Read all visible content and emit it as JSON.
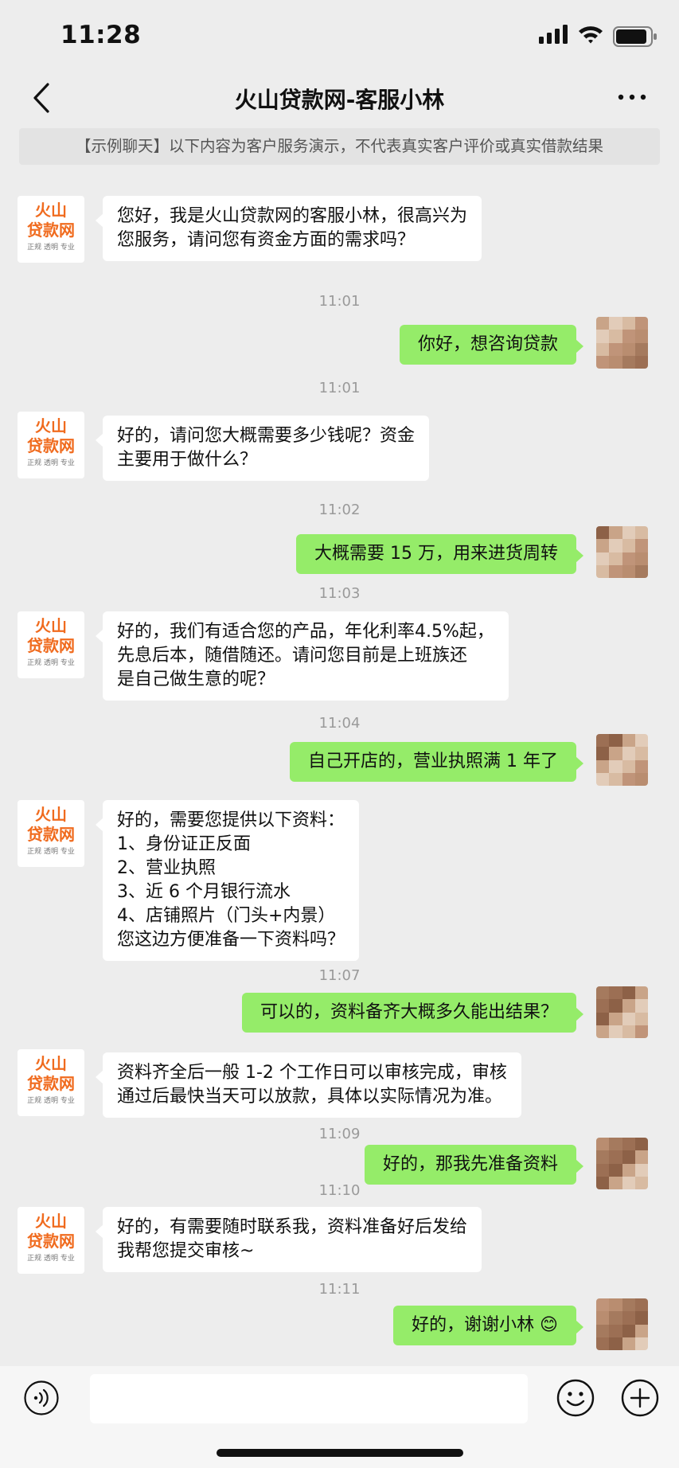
{
  "status_bar": {
    "time": "11:28",
    "icons": [
      "signal-icon",
      "wifi-icon",
      "battery-icon"
    ]
  },
  "header": {
    "title": "火山贷款网-客服小林",
    "back_icon": "chevron-left-icon",
    "more_icon": "more-dots-icon"
  },
  "notice": "【示例聊天】以下内容为客户服务演示，不代表真实客户评价或真实借款结果",
  "bot_avatar": {
    "line1": "火山",
    "line2": "贷款网",
    "line3": "正规 透明 专业",
    "color": "#f06b1e"
  },
  "messages": {
    "m1": {
      "lines": [
        "您好，我是火山贷款网的客服小林，很高兴为",
        "您服务，请问您有资金方面的需求吗？"
      ]
    },
    "t1": "11:01",
    "m2": {
      "text": "你好，想咨询贷款"
    },
    "t2": "11:01",
    "m3": {
      "lines": [
        "好的，请问您大概需要多少钱呢？资金",
        "主要用于做什么？"
      ]
    },
    "t3": "11:02",
    "m4": {
      "text": "大概需要 15 万，用来进货周转"
    },
    "t4": "11:03",
    "m5": {
      "lines": [
        "好的，我们有适合您的产品，年化利率4.5%起，",
        "先息后本，随借随还。请问您目前是上班族还",
        "是自己做生意的呢？"
      ]
    },
    "t5": "11:04",
    "m6": {
      "text": "自己开店的，营业执照满 1 年了"
    },
    "m7": {
      "lines": [
        "好的，需要您提供以下资料：",
        "1、身份证正反面",
        "2、营业执照",
        "3、近 6 个月银行流水",
        "4、店铺照片（门头+内景）",
        "您这边方便准备一下资料吗？"
      ]
    },
    "t6": "11:07",
    "m8": {
      "text": "可以的，资料备齐大概多久能出结果？"
    },
    "m9": {
      "lines": [
        "资料齐全后一般 1-2 个工作日可以审核完成，审核",
        "通过后最快当天可以放款，具体以实际情况为准。"
      ]
    },
    "t7": "11:09",
    "m10": {
      "text": "好的，那我先准备资料"
    },
    "t8": "11:10",
    "m11": {
      "lines": [
        "好的，有需要随时联系我，资料准备好后发给",
        "我帮您提交审核~"
      ]
    },
    "t9": "11:11",
    "m12": {
      "text": "好的，谢谢小林 😊"
    }
  },
  "input_bar": {
    "voice_icon": "voice-icon",
    "emoji_icon": "emoji-icon",
    "plus_icon": "plus-icon"
  },
  "colors": {
    "sent_bubble": "#95ec69",
    "received_bubble": "#ffffff",
    "background": "#ededed"
  }
}
